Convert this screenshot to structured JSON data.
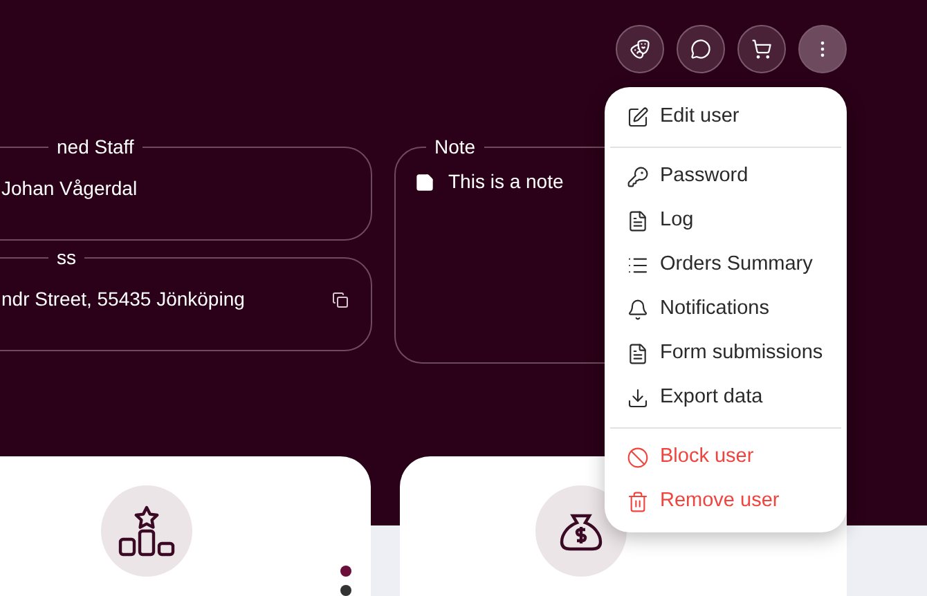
{
  "toolbar": [
    {
      "kind": "mask"
    },
    {
      "kind": "chat"
    },
    {
      "kind": "cart"
    },
    {
      "kind": "more"
    }
  ],
  "fields": [
    {
      "legend": "ned Staff",
      "value": "Johan Vågerdal",
      "copy": false
    },
    {
      "legend": "ss",
      "value": "ndr Street, 55435 Jönköping",
      "copy": true
    }
  ],
  "note": {
    "legend": "Note",
    "text": "This is a note"
  },
  "menu": [
    {
      "kind": "edit",
      "label": "Edit user",
      "danger": false,
      "divider_after": true
    },
    {
      "kind": "key",
      "label": "Password",
      "danger": false,
      "divider_after": false
    },
    {
      "kind": "doc",
      "label": "Log",
      "danger": false,
      "divider_after": false
    },
    {
      "kind": "list",
      "label": "Orders Summary",
      "danger": false,
      "divider_after": false
    },
    {
      "kind": "bell",
      "label": "Notifications",
      "danger": false,
      "divider_after": false
    },
    {
      "kind": "doc",
      "label": "Form submissions",
      "danger": false,
      "divider_after": false
    },
    {
      "kind": "download",
      "label": "Export data",
      "danger": false,
      "divider_after": true
    },
    {
      "kind": "ban",
      "label": "Block user",
      "danger": true,
      "divider_after": false
    },
    {
      "kind": "trash",
      "label": "Remove user",
      "danger": true,
      "divider_after": false
    }
  ],
  "cards": [
    {
      "kind": "podium"
    },
    {
      "kind": "money"
    }
  ]
}
